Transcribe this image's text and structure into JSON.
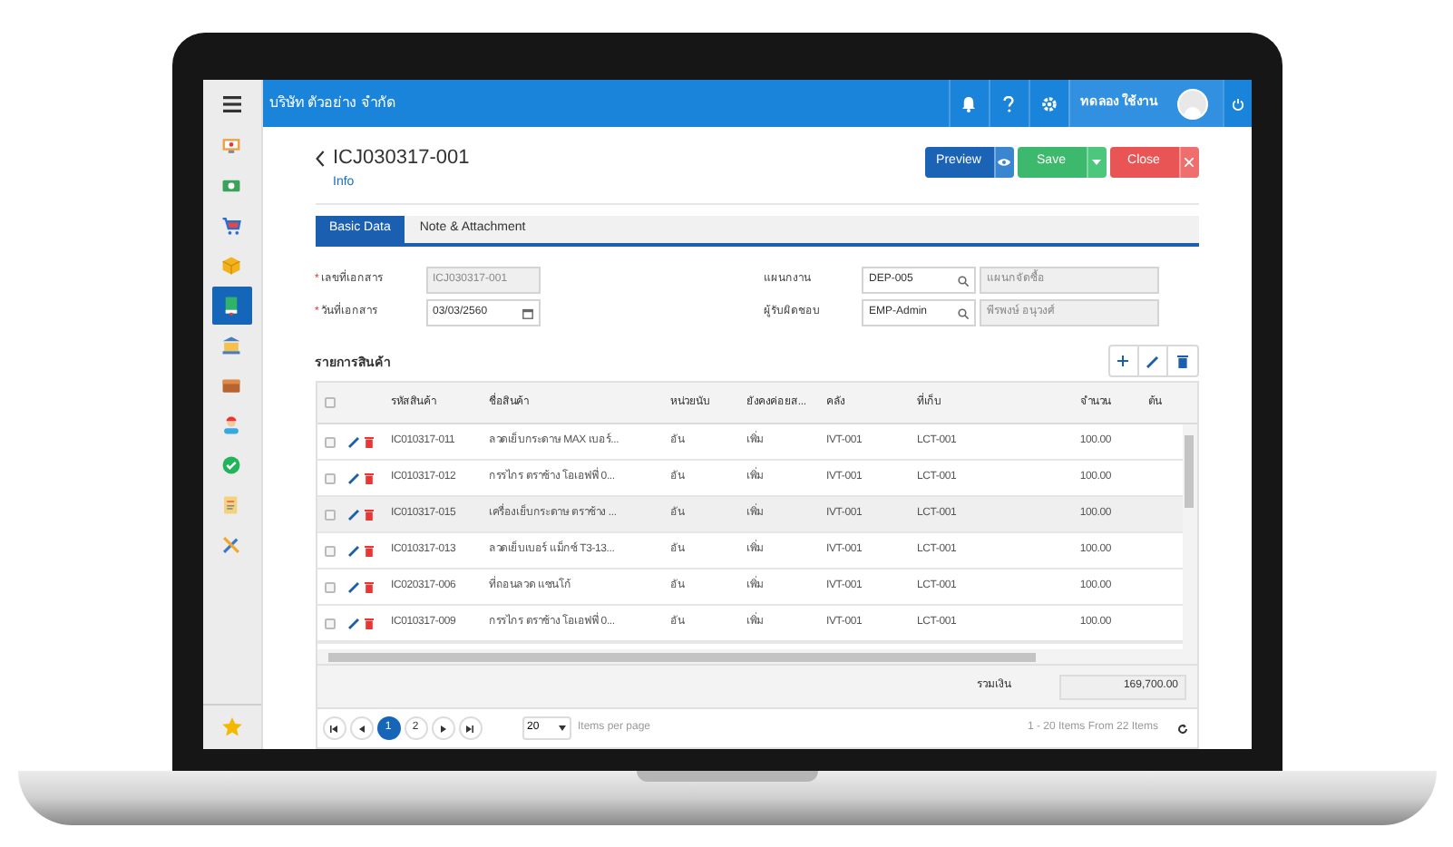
{
  "app_bar": {
    "company": "บริษัท ตัวอย่าง จำกัด",
    "user": "ทดลอง ใช้งาน"
  },
  "sidebar": {
    "items": [
      {
        "kind": "monitor",
        "selected": false
      },
      {
        "kind": "money",
        "selected": false
      },
      {
        "kind": "cart",
        "selected": false
      },
      {
        "kind": "box",
        "selected": false
      },
      {
        "kind": "book",
        "selected": true
      },
      {
        "kind": "bank",
        "selected": false
      },
      {
        "kind": "wallet",
        "selected": false
      },
      {
        "kind": "person",
        "selected": false
      },
      {
        "kind": "check",
        "selected": false
      },
      {
        "kind": "report",
        "selected": false
      },
      {
        "kind": "tools",
        "selected": false
      }
    ]
  },
  "document": {
    "title": "ICJ030317-001",
    "subtitle": "Info"
  },
  "actions": [
    {
      "kind": "preview",
      "label": "Preview"
    },
    {
      "kind": "save",
      "label": "Save"
    },
    {
      "kind": "close",
      "label": "Close"
    }
  ],
  "tabs": [
    {
      "label": "Basic Data",
      "selected": true
    },
    {
      "label": "Note & Attachment",
      "selected": false
    }
  ],
  "form": {
    "fields": [
      {
        "label": "เลขที่เอกสาร",
        "required_mark": "*",
        "kind": "readonly",
        "value": "ICJ030317-001"
      },
      {
        "label": "แผนกงาน",
        "kind": "lookup",
        "value": "DEP-005",
        "description": "แผนกจัดซื้อ"
      },
      {
        "label": "วันที่เอกสาร",
        "required_mark": "*",
        "kind": "date",
        "value": "03/03/2560"
      },
      {
        "label": "ผู้รับผิดชอบ",
        "kind": "lookup",
        "value": "EMP-Admin",
        "description": "พีรพงษ์ อนุวงศ์"
      }
    ]
  },
  "items": {
    "title": "รายการสินค้า",
    "select_all_checked": false,
    "columns": [
      "รหัสสินค้า",
      "ชื่อสินค้า",
      "หน่วยนับ",
      "ยังคงค่อยส...",
      "คลัง",
      "ที่เก็บ",
      "จำนวน",
      "ต้น"
    ],
    "rows": [
      {
        "selected": false,
        "checked": false,
        "cells": [
          "IC010317-011",
          "ลวดเย็บกระดาษ MAX เบอร์...",
          "อัน",
          "เพิ่ม",
          "IVT-001",
          "LCT-001",
          "100.00"
        ]
      },
      {
        "selected": false,
        "checked": false,
        "cells": [
          "IC010317-012",
          "กรรไกร ตราช้าง โอเอฟฟี่ 0...",
          "อัน",
          "เพิ่ม",
          "IVT-001",
          "LCT-001",
          "100.00"
        ]
      },
      {
        "selected": true,
        "checked": false,
        "cells": [
          "IC010317-015",
          "เครื่องเย็บกระดาษ ตราช้าง ...",
          "อัน",
          "เพิ่ม",
          "IVT-001",
          "LCT-001",
          "100.00"
        ]
      },
      {
        "selected": false,
        "checked": false,
        "cells": [
          "IC010317-013",
          "ลวดเย็บเบอร์ แม็กซ์ T3-13...",
          "อัน",
          "เพิ่ม",
          "IVT-001",
          "LCT-001",
          "100.00"
        ]
      },
      {
        "selected": false,
        "checked": false,
        "cells": [
          "IC020317-006",
          "ที่ถอนลวด แซนโก้",
          "อัน",
          "เพิ่ม",
          "IVT-001",
          "LCT-001",
          "100.00"
        ]
      },
      {
        "selected": false,
        "checked": false,
        "cells": [
          "IC010317-009",
          "กรรไกร ตราช้าง โอเอฟฟี่ 0...",
          "อัน",
          "เพิ่ม",
          "IVT-001",
          "LCT-001",
          "100.00"
        ]
      }
    ],
    "total_label": "รวมเงิน",
    "total": "169,700.00"
  },
  "pager": {
    "pages": [
      {
        "label": "1",
        "selected": true
      },
      {
        "label": "2",
        "selected": false
      }
    ],
    "page_size": "20",
    "page_size_label": "Items per page",
    "summary": "1 - 20 Items From 22 Items"
  }
}
